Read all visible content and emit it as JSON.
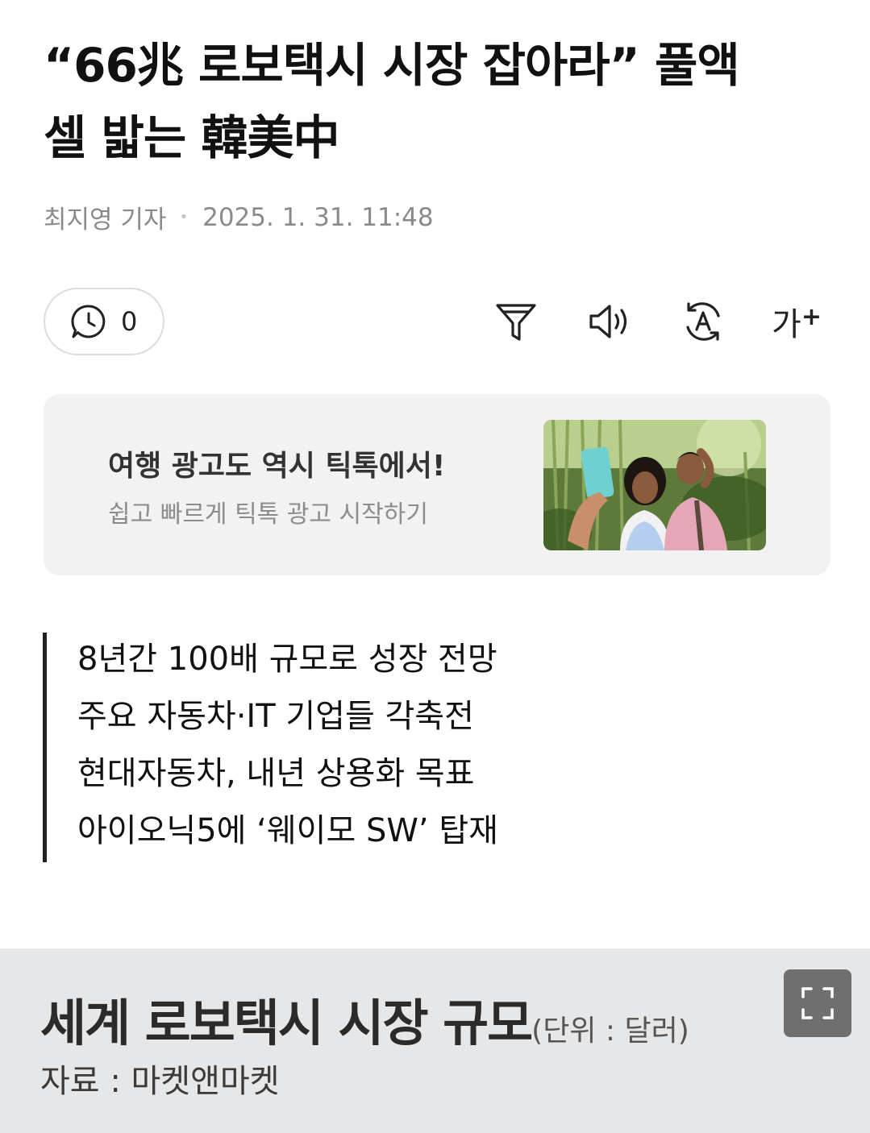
{
  "article": {
    "headline_line1": "“66兆 로보택시 시장 잡아라” 풀액",
    "headline_line2": "셀 밟는 韓美中",
    "reporter": "최지영 기자",
    "date": "2025. 1. 31. 11:48"
  },
  "toolbar": {
    "comment_count": "0",
    "font_size_label": "가",
    "font_size_plus": "+"
  },
  "ad": {
    "title": "여행 광고도 역시 틱톡에서!",
    "subtitle": "쉽고 빠르게 틱톡 광고 시작하기"
  },
  "summary": [
    "8년간 100배 규모로 성장 전망",
    "주요 자동차·IT 기업들 각축전",
    "현대자동차, 내년 상용화 목표",
    "아이오닉5에 ‘웨이모 SW’ 탑재"
  ],
  "figure": {
    "title": "세계 로보택시 시장 규모",
    "unit": "(단위 : 달러)",
    "source": "자료 : 마켓앤마켓"
  }
}
